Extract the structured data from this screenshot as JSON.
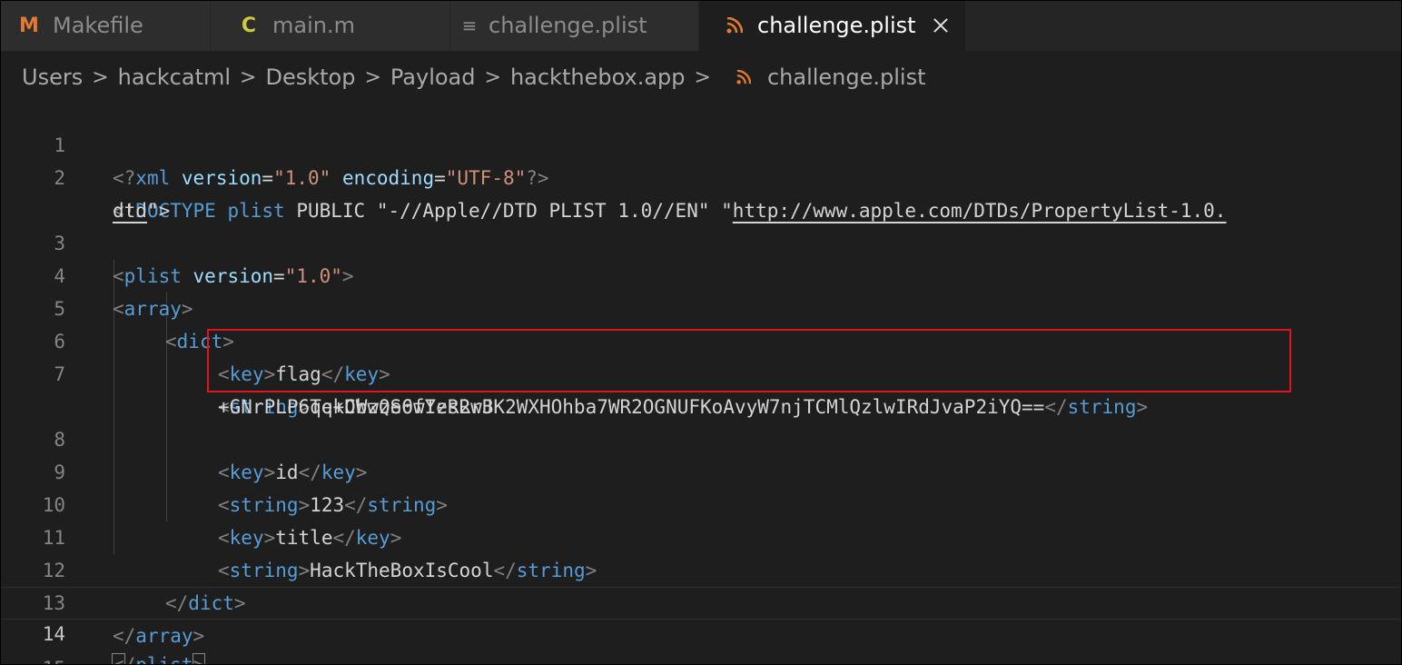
{
  "tabs": [
    {
      "label": "Makefile",
      "icon": "makefile-icon",
      "icon_glyph": "M",
      "icon_color": "#e37933"
    },
    {
      "label": "main.m",
      "icon": "c-language-icon",
      "icon_glyph": "C",
      "icon_color": "#cbcb41"
    },
    {
      "label": "challenge.plist",
      "icon": "text-file-icon",
      "icon_glyph": "≡",
      "icon_color": "#8c8c8c"
    },
    {
      "label": "challenge.plist",
      "icon": "rss-icon",
      "icon_color": "#e37933",
      "active": true
    }
  ],
  "breadcrumb": {
    "items": [
      "Users",
      "hackcatml",
      "Desktop",
      "Payload",
      "hackthebox.app"
    ],
    "file": "challenge.plist",
    "separator": ">"
  },
  "editor": {
    "line_numbers": [
      "1",
      "2",
      "3",
      "4",
      "5",
      "6",
      "7",
      "8",
      "9",
      "10",
      "11",
      "12",
      "13",
      "14",
      "15"
    ],
    "current_line": "14",
    "lines": {
      "l1": {
        "open": "<?",
        "tag": "xml",
        "a1": "version",
        "eq1": "=",
        "v1": "\"1.0\"",
        "a2": "encoding",
        "eq2": "=",
        "v2": "\"UTF-8\"",
        "close": "?>"
      },
      "l2": {
        "open": "<!",
        "tag": "DOCTYPE",
        "kw": "plist",
        "rest": " PUBLIC \"-//Apple//DTD PLIST 1.0//EN\" \"",
        "url1": "http://www.apple.com/DTDs/PropertyList-1.0.",
        "url2": "dtd",
        "end": "\">"
      },
      "l3": {
        "open": "<",
        "tag": "plist",
        "attr": "version",
        "eq": "=",
        "val": "\"1.0\"",
        "close": ">"
      },
      "l4": {
        "open": "<",
        "tag": "array",
        "close": ">"
      },
      "l5": {
        "open": "<",
        "tag": "dict",
        "close": ">"
      },
      "l6": {
        "tag": "key",
        "text": "flag"
      },
      "l7": {
        "tag": "string",
        "text1": "Tq+CWzQS0wYzs2rJ",
        "text2": "+GNrPLP6qekDbwze6fIeRRwBK2WXHOhba7WR2OGNUFKoAvyW7njTCMlQzlwIRdJvaP2iYQ=="
      },
      "l8": {
        "tag": "key",
        "text": "id"
      },
      "l9": {
        "tag": "string",
        "text": "123"
      },
      "l10": {
        "tag": "key",
        "text": "title"
      },
      "l11": {
        "tag": "string",
        "text": "HackTheBoxIsCool"
      },
      "l12": {
        "tag": "dict"
      },
      "l13": {
        "tag": "array"
      },
      "l14": {
        "tag": "plist"
      }
    },
    "highlight_color": "#e0141e"
  }
}
